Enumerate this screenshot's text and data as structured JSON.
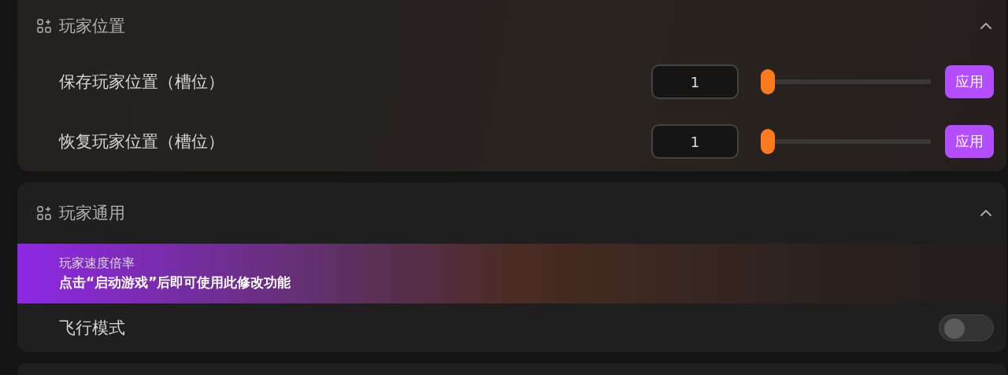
{
  "sections": [
    {
      "title": "玩家位置",
      "expanded": true,
      "rows": [
        {
          "kind": "slider",
          "label": "保存玩家位置（槽位）",
          "value": "1",
          "level": 0,
          "button": "应用"
        },
        {
          "kind": "slider",
          "label": "恢复玩家位置（槽位）",
          "value": "1",
          "level": 0,
          "button": "应用"
        }
      ]
    },
    {
      "title": "玩家通用",
      "expanded": true,
      "rows": [
        {
          "kind": "locked",
          "label": "玩家速度倍率",
          "notice": "点击“启动游戏”后即可使用此修改功能"
        },
        {
          "kind": "toggle",
          "label": "飞行模式",
          "on": false
        }
      ]
    }
  ]
}
